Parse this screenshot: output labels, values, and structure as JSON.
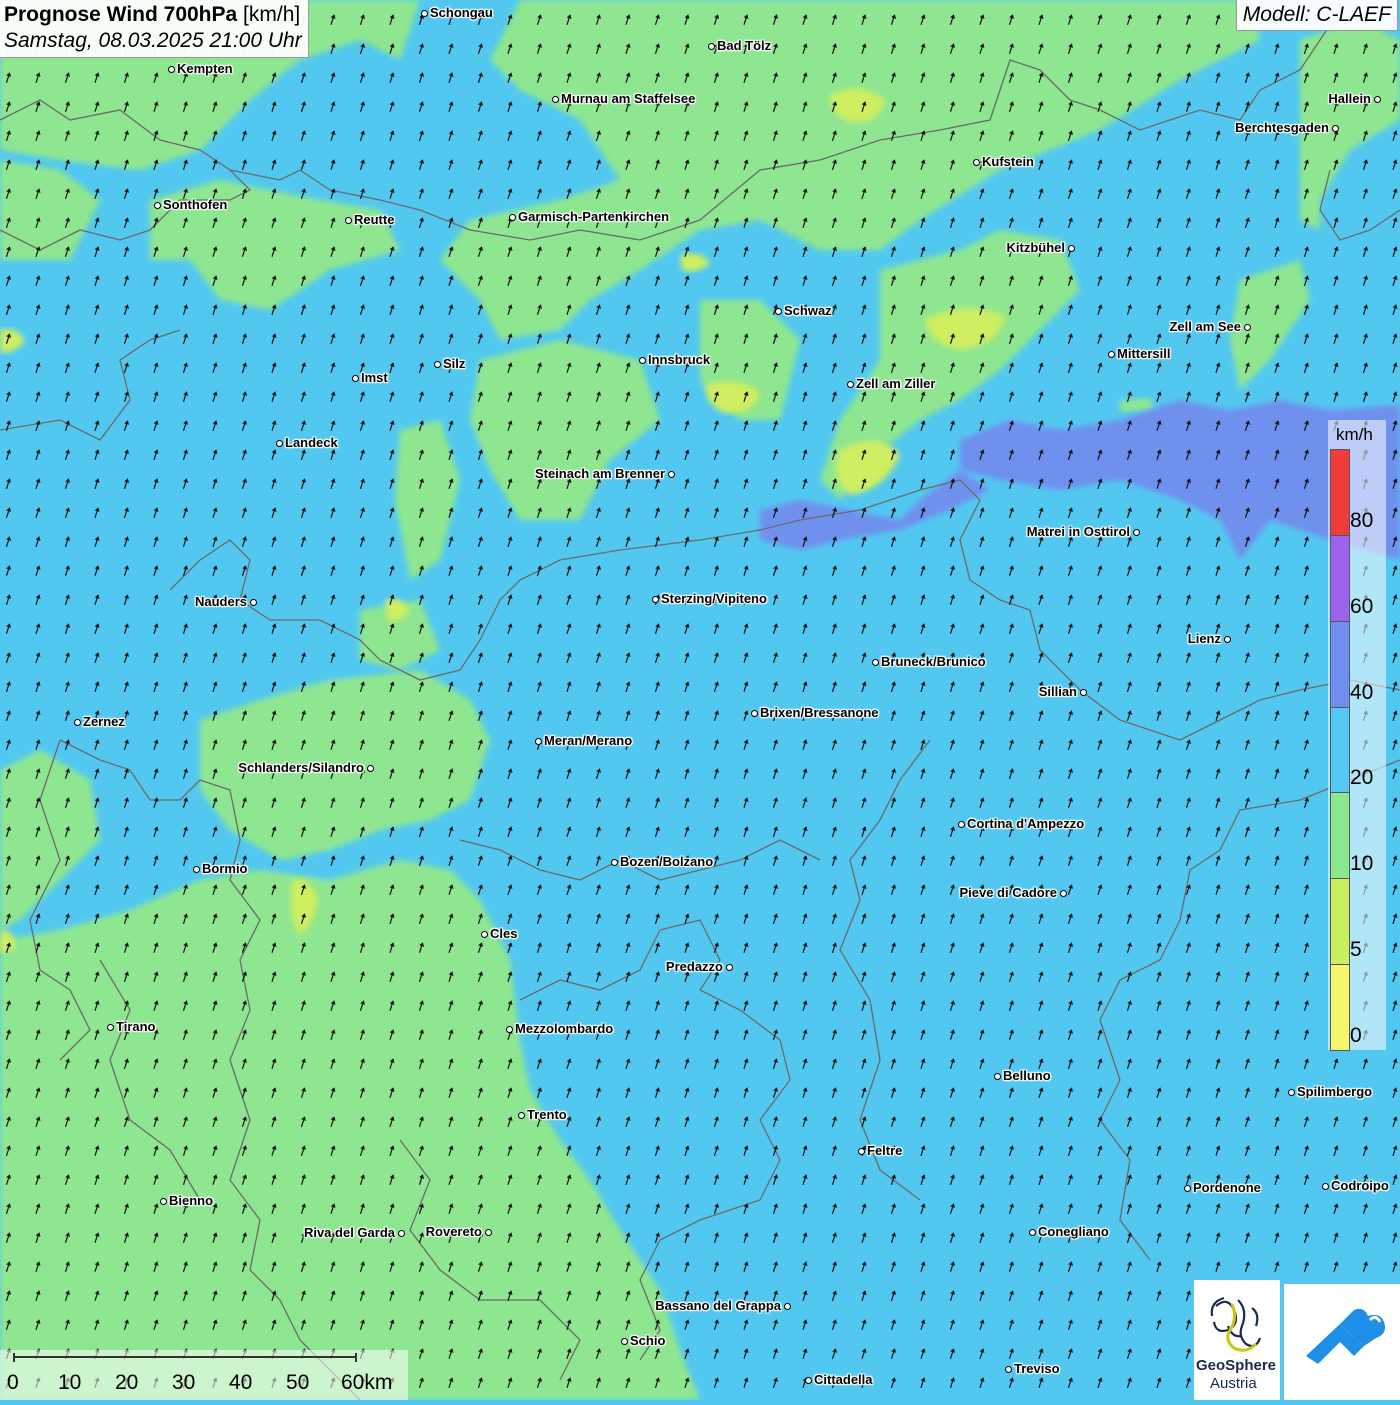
{
  "title": {
    "main": "Prognose Wind 700hPa",
    "unit": "[km/h]",
    "datetime": "Samstag, 08.03.2025 21:00 Uhr"
  },
  "model": "Modell: C-LAEF",
  "legend": {
    "unit": "km/h",
    "classes": [
      {
        "color": "#f5f56a",
        "ticks": "0"
      },
      {
        "color": "#c9ef5e",
        "ticks": "5"
      },
      {
        "color": "#8ce88f",
        "ticks": "10"
      },
      {
        "color": "#55c9f3",
        "ticks": "20"
      },
      {
        "color": "#6f8ef2",
        "ticks": "40"
      },
      {
        "color": "#9c63ec",
        "ticks": "60"
      },
      {
        "color": "#f03c3c",
        "ticks": "80"
      }
    ]
  },
  "colors": {
    "wind_20_40": "#52c8f0",
    "wind_10_20": "#8fe690",
    "wind_5_10": "#cfee60",
    "wind_40_60": "#7090ee",
    "border": "#6a6a6a",
    "arrow": "#111111"
  },
  "scale_bar": {
    "labels": [
      "0",
      "10",
      "20",
      "30",
      "40",
      "50",
      "60km"
    ]
  },
  "wind_direction": "north-northeast",
  "cities": [
    {
      "name": "Schongau",
      "side": "r"
    },
    {
      "name": "Bad Tölz",
      "side": "r"
    },
    {
      "name": "Kempten",
      "side": "r"
    },
    {
      "name": "Murnau am Staffelsee",
      "side": "r"
    },
    {
      "name": "Hallein",
      "side": "l"
    },
    {
      "name": "Berchtesgaden",
      "side": "l"
    },
    {
      "name": "Kufstein",
      "side": "r"
    },
    {
      "name": "Sonthofen",
      "side": "r"
    },
    {
      "name": "Reutte",
      "side": "r"
    },
    {
      "name": "Garmisch-Partenkirchen",
      "side": "r"
    },
    {
      "name": "Kitzbühel",
      "side": "l"
    },
    {
      "name": "Schwaz",
      "side": "r"
    },
    {
      "name": "Zell am See",
      "side": "l"
    },
    {
      "name": "Mittersill",
      "side": "r"
    },
    {
      "name": "Innsbruck",
      "side": "r"
    },
    {
      "name": "Silz",
      "side": "r"
    },
    {
      "name": "Imst",
      "side": "r"
    },
    {
      "name": "Zell am Ziller",
      "side": "r"
    },
    {
      "name": "Landeck",
      "side": "r"
    },
    {
      "name": "Steinach am Brenner",
      "side": "l"
    },
    {
      "name": "Matrei in Osttirol",
      "side": "l"
    },
    {
      "name": "Nauders",
      "side": "l"
    },
    {
      "name": "Sterzing/Vipiteno",
      "side": "r"
    },
    {
      "name": "Lienz",
      "side": "l"
    },
    {
      "name": "Bruneck/Brunico",
      "side": "r"
    },
    {
      "name": "Sillian",
      "side": "l"
    },
    {
      "name": "Zernez",
      "side": "r"
    },
    {
      "name": "Brixen/Bressanone",
      "side": "r"
    },
    {
      "name": "Meran/Merano",
      "side": "r"
    },
    {
      "name": "Schlanders/Silandro",
      "side": "l"
    },
    {
      "name": "Cortina d'Ampezzo",
      "side": "r"
    },
    {
      "name": "Bozen/Bolzano",
      "side": "r"
    },
    {
      "name": "Bormio",
      "side": "r"
    },
    {
      "name": "Pieve di Cadore",
      "side": "l"
    },
    {
      "name": "Cles",
      "side": "r"
    },
    {
      "name": "Predazzo",
      "side": "l"
    },
    {
      "name": "Tirano",
      "side": "r"
    },
    {
      "name": "Mezzolombardo",
      "side": "r"
    },
    {
      "name": "Belluno",
      "side": "r"
    },
    {
      "name": "Spilimbergo",
      "side": "r"
    },
    {
      "name": "Trento",
      "side": "r"
    },
    {
      "name": "Feltre",
      "side": "r"
    },
    {
      "name": "Pordenone",
      "side": "r"
    },
    {
      "name": "Codroipo",
      "side": "r"
    },
    {
      "name": "Bienno",
      "side": "r"
    },
    {
      "name": "Riva del Garda",
      "side": "l"
    },
    {
      "name": "Rovereto",
      "side": "l"
    },
    {
      "name": "Conegliano",
      "side": "r"
    },
    {
      "name": "Bassano del Grappa",
      "side": "l"
    },
    {
      "name": "Schio",
      "side": "r"
    },
    {
      "name": "Treviso",
      "side": "r"
    },
    {
      "name": "Cittadella",
      "side": "r"
    }
  ],
  "logos": {
    "geosphere_line1": "GeoSphere",
    "geosphere_line2": "Austria"
  }
}
